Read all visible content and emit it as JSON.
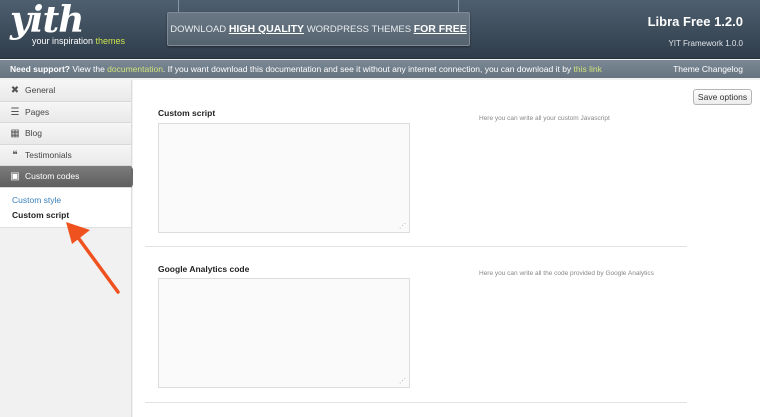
{
  "header": {
    "logo_word": "yith",
    "logo_tag_prefix": "your inspiration ",
    "logo_tag_highlight": "themes",
    "banner": {
      "part1": "DOWNLOAD ",
      "part2": "HIGH QUALITY",
      "part3": " WORDPRESS THEMES ",
      "part4": "FOR FREE"
    },
    "version_title": "Libra Free 1.2.0",
    "framework": "YIT Framework 1.0.0"
  },
  "support": {
    "bold": "Need support?",
    "t1": " View the ",
    "link1": "documentation",
    "t2": ". If you want download this documentation and see it without any internet connection, you can download it by ",
    "link2": "this link",
    "changelog": "Theme Changelog"
  },
  "sidebar": {
    "items": [
      {
        "label": "General",
        "icon": "wrench-icon",
        "glyph": "✖"
      },
      {
        "label": "Pages",
        "icon": "list-icon",
        "glyph": "☰"
      },
      {
        "label": "Blog",
        "icon": "calendar-icon",
        "glyph": "▦"
      },
      {
        "label": "Testimonials",
        "icon": "quote-icon",
        "glyph": "❝"
      },
      {
        "label": "Custom codes",
        "icon": "code-window-icon",
        "glyph": "▣"
      }
    ],
    "sub": [
      "Custom style",
      "Custom script"
    ]
  },
  "content": {
    "save_label": "Save options",
    "fields": [
      {
        "title": "Custom script",
        "value": "",
        "desc": "Here you can write all your custom Javascript"
      },
      {
        "title": "Google Analytics code",
        "value": "",
        "desc": "Here you can write all the code provided by Google Analytics"
      }
    ]
  },
  "colors": {
    "header_dark": "#2f3d4b",
    "support_bar": "#6f7d8a",
    "accent_green": "#c9e34a",
    "arrow": "#f0521f",
    "link_blue": "#3b7fb8"
  }
}
